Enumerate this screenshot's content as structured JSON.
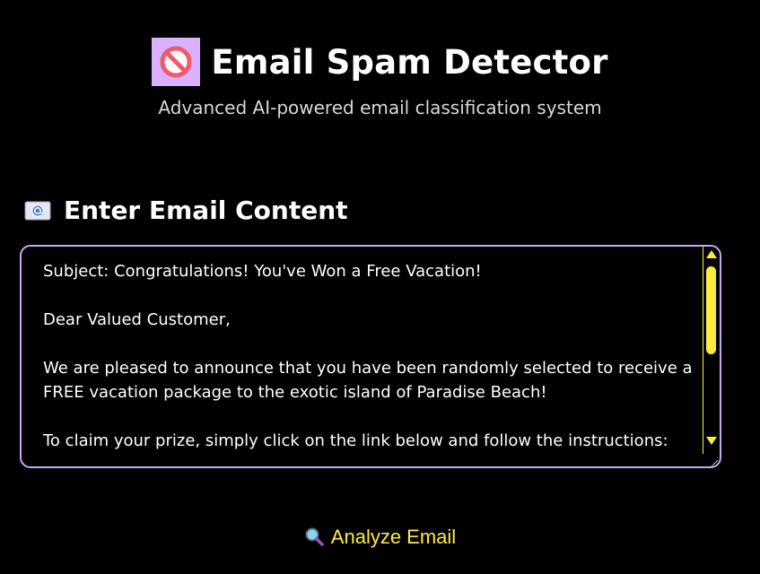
{
  "header": {
    "logo_icon": "no-entry-icon",
    "title": "Email Spam Detector",
    "subtitle": "Advanced AI-powered email classification system"
  },
  "input_section": {
    "icon": "envelope-at-icon",
    "heading": "Enter Email Content",
    "email_text": "Subject: Congratulations! You've Won a Free Vacation!\n\nDear Valued Customer,\n\nWe are pleased to announce that you have been randomly selected to receive a FREE vacation package to the exotic island of Paradise Beach!\n\nTo claim your prize, simply click on the link below and follow the instructions:"
  },
  "actions": {
    "analyze_icon": "magnifier-icon",
    "analyze_label": "Analyze Email"
  },
  "colors": {
    "background": "#000000",
    "accent_yellow": "#ffeb3b",
    "accent_lavender": "#c9a7f5",
    "logo_bg": "#d9b3ff"
  }
}
